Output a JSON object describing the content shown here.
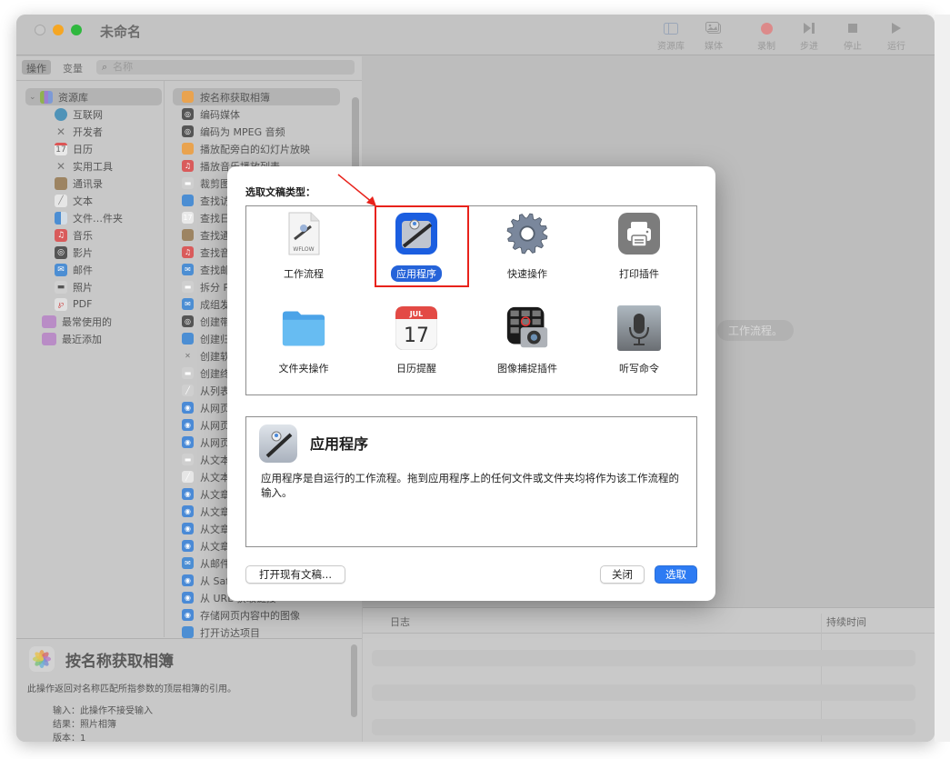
{
  "window": {
    "title": "未命名",
    "toolbar": [
      {
        "label": "资源库",
        "icon": "library-sidebar-icon"
      },
      {
        "label": "媒体",
        "icon": "media-icon"
      },
      {
        "label": "录制",
        "icon": "record-icon"
      },
      {
        "label": "步进",
        "icon": "step-icon"
      },
      {
        "label": "停止",
        "icon": "stop-icon"
      },
      {
        "label": "运行",
        "icon": "run-icon"
      }
    ]
  },
  "left_panel": {
    "tabs": [
      {
        "label": "操作",
        "active": true
      },
      {
        "label": "变量",
        "active": false
      }
    ],
    "search_placeholder": "名称",
    "library": {
      "root": "资源库",
      "items": [
        "互联网",
        "开发者",
        "日历",
        "实用工具",
        "通讯录",
        "文本",
        "文件…件夹",
        "音乐",
        "影片",
        "邮件",
        "照片",
        "PDF"
      ],
      "extra": [
        "最常使用的",
        "最近添加"
      ]
    },
    "actions": [
      "按名称获取相簿",
      "编码媒体",
      "编码为 MPEG 音频",
      "播放配旁白的幻灯片放映",
      "播放音乐播放列表",
      "裁剪图",
      "查找访",
      "查找日",
      "查找通",
      "查找音",
      "查找邮",
      "拆分 P",
      "成组发",
      "创建带",
      "创建归",
      "创建软",
      "创建终",
      "从列表",
      "从网页",
      "从网页",
      "从网页",
      "从文本",
      "从文本",
      "从文章",
      "从文章",
      "从文章",
      "从文章",
      "从邮件",
      "从 Saf",
      "从 URL 获取链接",
      "存储网页内容中的图像",
      "打开访达项目"
    ],
    "info": {
      "title": "按名称获取相簿",
      "description": "此操作返回对名称匹配所指参数的顶层相簿的引用。",
      "input": "输入：此操作不接受输入",
      "result": "结果：照片相簿",
      "version": "版本：1"
    }
  },
  "workflow_area": {
    "hint": "工作流程。",
    "log": {
      "columns": [
        "日志",
        "持续时间"
      ]
    }
  },
  "dialog": {
    "label": "选取文稿类型：",
    "types": [
      {
        "name": "工作流程",
        "icon": "workflow-file-icon",
        "file_tag": "WFLOW",
        "selected": false
      },
      {
        "name": "应用程序",
        "icon": "automator-app-icon",
        "selected": true
      },
      {
        "name": "快速操作",
        "icon": "gear-icon",
        "selected": false
      },
      {
        "name": "打印插件",
        "icon": "printer-icon",
        "selected": false
      },
      {
        "name": "文件夹操作",
        "icon": "folder-icon",
        "selected": false
      },
      {
        "name": "日历提醒",
        "icon": "calendar-icon",
        "cal_month": "JUL",
        "cal_day": "17",
        "selected": false
      },
      {
        "name": "图像捕捉插件",
        "icon": "image-capture-icon",
        "selected": false
      },
      {
        "name": "听写命令",
        "icon": "microphone-icon",
        "selected": false
      }
    ],
    "description": {
      "title": "应用程序",
      "text": "应用程序是自运行的工作流程。拖到应用程序上的任何文件或文件夹均将作为该工作流程的输入。"
    },
    "buttons": {
      "open_existing": "打开现有文稿...",
      "close": "关闭",
      "choose": "选取"
    },
    "accent": "#2d7bf3",
    "annotation_color": "#e8221b"
  }
}
